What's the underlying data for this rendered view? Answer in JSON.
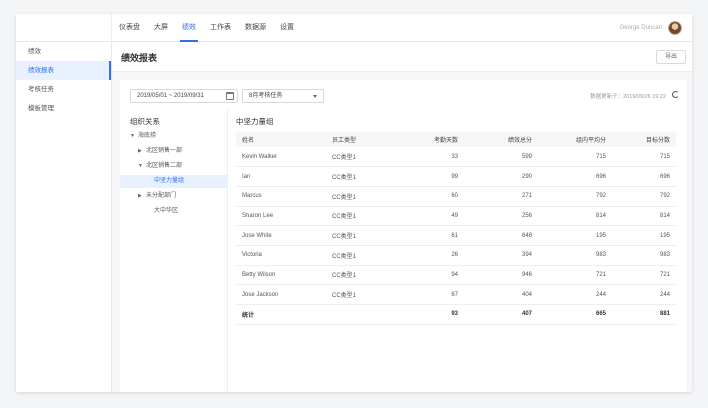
{
  "nav": {
    "items": [
      {
        "label": "仪表盘",
        "active": false
      },
      {
        "label": "大屏",
        "active": false
      },
      {
        "label": "绩效",
        "active": true
      },
      {
        "label": "工作表",
        "active": false
      },
      {
        "label": "数据源",
        "active": false
      },
      {
        "label": "设置",
        "active": false
      }
    ],
    "user_name": "George Duncan"
  },
  "sidebar": {
    "items": [
      {
        "label": "绩效",
        "active": false
      },
      {
        "label": "绩效报表",
        "active": true
      },
      {
        "label": "考核任务",
        "active": false
      },
      {
        "label": "模板管理",
        "active": false
      }
    ]
  },
  "page": {
    "title": "绩效报表",
    "export_label": "导出"
  },
  "filters": {
    "date_range": "2019/05/01 ~ 2019/09/31",
    "task": "8月考核任务",
    "update_time": "数据更新于：2019/09/26 19:22"
  },
  "tree": {
    "title": "组织关系",
    "items": [
      {
        "label": "海底捞",
        "arrow": "▼",
        "indent": 0,
        "selected": false
      },
      {
        "label": "北区销售一部",
        "arrow": "▶",
        "indent": 1,
        "selected": false
      },
      {
        "label": "北区销售二部",
        "arrow": "▼",
        "indent": 1,
        "selected": false
      },
      {
        "label": "中坚力量组",
        "arrow": "",
        "indent": 2,
        "selected": true
      },
      {
        "label": "未分配部门",
        "arrow": "▶",
        "indent": 1,
        "selected": false
      },
      {
        "label": "大中华区",
        "arrow": "",
        "indent": 2,
        "selected": false
      }
    ]
  },
  "table": {
    "title": "中坚力量组",
    "headers": [
      "姓名",
      "员工类型",
      "考勤天数",
      "绩效总分",
      "组内平均分",
      "目标分数"
    ],
    "rows": [
      [
        "Kevin Walker",
        "CC类型1",
        "33",
        "599",
        "715",
        "715"
      ],
      [
        "Ian",
        "CC类型1",
        "99",
        "290",
        "696",
        "696"
      ],
      [
        "Marcus",
        "CC类型1",
        "60",
        "271",
        "792",
        "792"
      ],
      [
        "Sharon Lee",
        "CC类型1",
        "49",
        "256",
        "814",
        "814"
      ],
      [
        "Jose White",
        "CC类型1",
        "61",
        "648",
        "195",
        "195"
      ],
      [
        "Victoria",
        "CC类型1",
        "26",
        "394",
        "983",
        "983"
      ],
      [
        "Betty Wilson",
        "CC类型1",
        "94",
        "946",
        "721",
        "721"
      ],
      [
        "Jose Jackson",
        "CC类型1",
        "67",
        "404",
        "244",
        "244"
      ]
    ],
    "total": [
      "统计",
      "",
      "93",
      "407",
      "665",
      "881"
    ]
  },
  "colors": {
    "accent": "#2f6fec",
    "active_bg": "#eaf1fe"
  }
}
